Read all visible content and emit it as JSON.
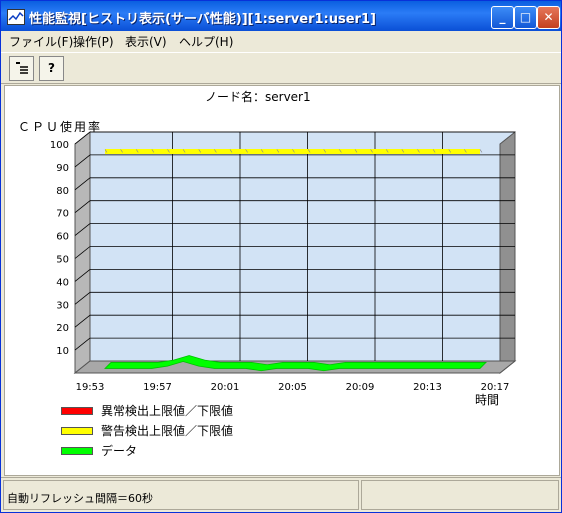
{
  "window": {
    "title": "性能監視[ヒストリ表示(サーバ性能)][1:server1:user1]"
  },
  "title_buttons": {
    "minimize": "_",
    "maximize": "□",
    "close": "✕"
  },
  "menu": {
    "items": [
      {
        "label": "ファイル(F)"
      },
      {
        "label": "操作(P)"
      },
      {
        "label": "表示(V)"
      },
      {
        "label": "ヘルプ(H)"
      }
    ]
  },
  "toolbar": {
    "buttons": [
      {
        "icon": "list-icon"
      },
      {
        "icon": "help-icon",
        "label": "?"
      }
    ]
  },
  "node": {
    "label": "ノード名：server1"
  },
  "chart_data": {
    "type": "area",
    "ylabel": "ＣＰＵ使用率",
    "xlabel": "時間",
    "ylim": [
      0,
      100
    ],
    "yticks": [
      10,
      20,
      30,
      40,
      50,
      60,
      70,
      80,
      90,
      100
    ],
    "xticks": [
      "19:53",
      "19:57",
      "20:01",
      "20:05",
      "20:09",
      "20:13",
      "20:17"
    ],
    "grid": true,
    "series": [
      {
        "name": "異常検出上限値／下限値",
        "color": "#ff0000",
        "values": []
      },
      {
        "name": "警告検出上限値／下限値",
        "color": "#ffff00",
        "values": [
          95,
          95,
          95,
          95,
          95,
          95,
          95,
          95,
          95,
          95,
          95,
          95,
          95,
          95,
          95,
          95,
          95,
          95,
          95,
          95,
          95,
          95,
          95,
          95,
          95
        ]
      },
      {
        "name": "データ",
        "color": "#00ff00",
        "values": [
          2,
          2,
          2,
          2,
          3,
          5,
          3,
          2,
          2,
          2,
          1,
          2,
          2,
          2,
          1,
          2,
          2,
          2,
          2,
          2,
          2,
          2,
          2,
          2,
          2
        ]
      }
    ]
  },
  "legend": {
    "placement": "bottom-left"
  },
  "status": {
    "refresh": "自動リフレッシュ間隔＝60秒",
    "pane2": ""
  }
}
